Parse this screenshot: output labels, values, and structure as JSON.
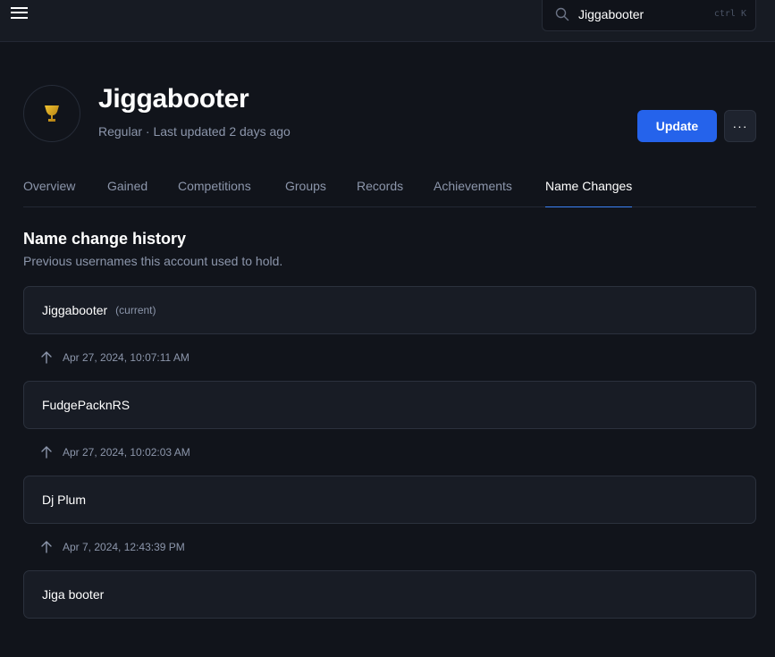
{
  "topbar": {
    "menu_icon": "hamburger-menu-icon",
    "search": {
      "icon": "search-icon",
      "value": "Jiggabooter",
      "shortcut": "ctrl K"
    }
  },
  "player": {
    "avatar_icon": "trophy-icon",
    "avatar_color": "#d4a017",
    "name": "Jiggabooter",
    "meta": "Regular · Last updated 2 days ago",
    "update_label": "Update",
    "more_label": "···",
    "accent": "#2563eb"
  },
  "tabs": [
    {
      "label": "Overview",
      "active": false
    },
    {
      "label": "Gained",
      "active": false
    },
    {
      "label": "Competitions",
      "active": false
    },
    {
      "label": "Groups",
      "active": false
    },
    {
      "label": "Records",
      "active": false
    },
    {
      "label": "Achievements",
      "active": false
    },
    {
      "label": "Name Changes",
      "active": true
    }
  ],
  "history": {
    "title": "Name change history",
    "subtitle": "Previous usernames this account used to hold.",
    "current_tag": "(current)",
    "names": [
      {
        "name": "Jiggabooter",
        "current": true
      },
      {
        "name": "FudgePacknRS",
        "current": false
      },
      {
        "name": "Dj Plum",
        "current": false
      },
      {
        "name": "Jiga booter",
        "current": false
      }
    ],
    "changes": [
      {
        "icon": "arrow-up-icon",
        "date": "Apr 27, 2024, 10:07:11 AM"
      },
      {
        "icon": "arrow-up-icon",
        "date": "Apr 27, 2024, 10:02:03 AM"
      },
      {
        "icon": "arrow-up-icon",
        "date": "Apr 7, 2024, 12:43:39 PM"
      }
    ]
  }
}
